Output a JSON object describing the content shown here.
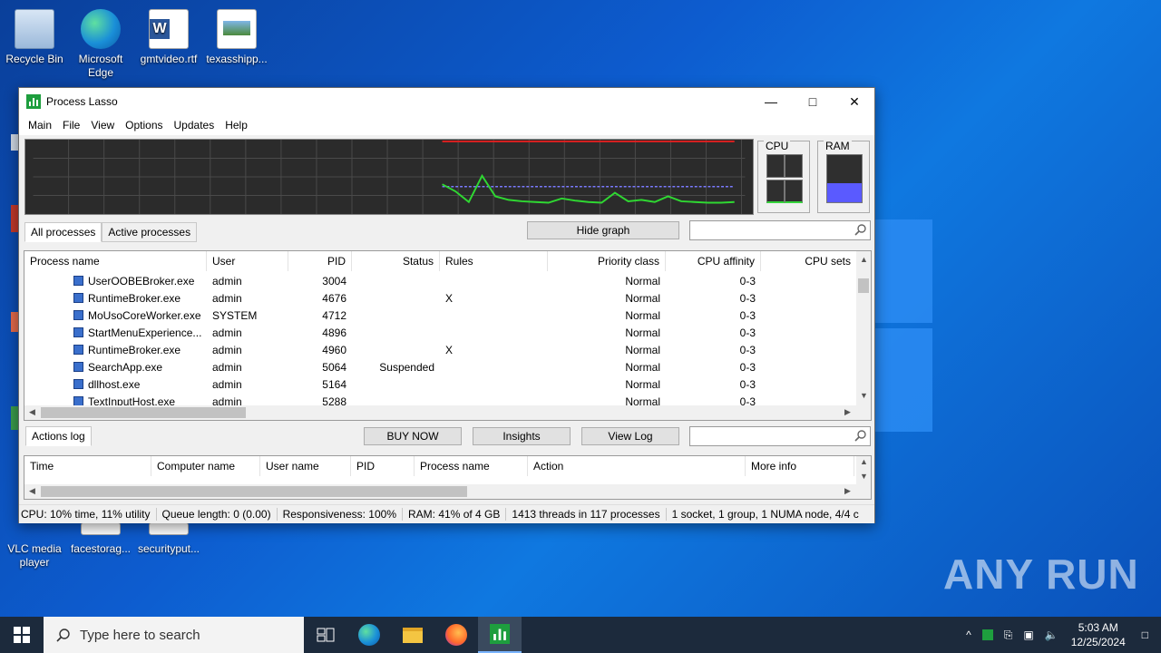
{
  "desktop": {
    "icons_top": [
      {
        "label": "Recycle Bin"
      },
      {
        "label": "Microsoft Edge"
      },
      {
        "label": "gmtvideo.rtf"
      },
      {
        "label": "texasshipp..."
      }
    ],
    "icons_bottom": [
      {
        "label": "VLC media player"
      },
      {
        "label": "facestorag..."
      },
      {
        "label": "securityput..."
      }
    ],
    "watermark": "ANY  RUN"
  },
  "window": {
    "title": "Process Lasso",
    "menu": [
      "Main",
      "File",
      "View",
      "Options",
      "Updates",
      "Help"
    ],
    "graph": {
      "cpu_line": [
        0,
        0,
        0,
        0,
        0,
        0,
        0,
        0,
        0,
        0,
        0,
        0,
        0.32,
        0.22,
        0.07,
        0.44,
        0.15,
        0.1,
        0.08,
        0.07,
        0.06,
        0.12,
        0.09,
        0.07,
        0.06,
        0.2,
        0.08,
        0.1,
        0.07,
        0.15,
        0.08,
        0.07,
        0.06,
        0.06,
        0.07
      ],
      "ram_level": 0.41
    },
    "meters": {
      "cpu_label": "CPU",
      "ram_label": "RAM",
      "ram_fill": 0.41
    },
    "tabs": {
      "all": "All processes",
      "active": "Active processes"
    },
    "hide_graph": "Hide graph",
    "process_table": {
      "columns": [
        "Process name",
        "User",
        "PID",
        "Status",
        "Rules",
        "Priority class",
        "CPU affinity",
        "CPU sets"
      ],
      "rows": [
        {
          "name": "UserOOBEBroker.exe",
          "user": "admin",
          "pid": "3004",
          "status": "",
          "rules": "",
          "priority": "Normal",
          "affinity": "0-3"
        },
        {
          "name": "RuntimeBroker.exe",
          "user": "admin",
          "pid": "4676",
          "status": "",
          "rules": "X",
          "priority": "Normal",
          "affinity": "0-3"
        },
        {
          "name": "MoUsoCoreWorker.exe",
          "user": "SYSTEM",
          "pid": "4712",
          "status": "",
          "rules": "",
          "priority": "Normal",
          "affinity": "0-3"
        },
        {
          "name": "StartMenuExperience...",
          "user": "admin",
          "pid": "4896",
          "status": "",
          "rules": "",
          "priority": "Normal",
          "affinity": "0-3"
        },
        {
          "name": "RuntimeBroker.exe",
          "user": "admin",
          "pid": "4960",
          "status": "",
          "rules": "X",
          "priority": "Normal",
          "affinity": "0-3"
        },
        {
          "name": "SearchApp.exe",
          "user": "admin",
          "pid": "5064",
          "status": "Suspended",
          "rules": "",
          "priority": "Normal",
          "affinity": "0-3"
        },
        {
          "name": "dllhost.exe",
          "user": "admin",
          "pid": "5164",
          "status": "",
          "rules": "",
          "priority": "Normal",
          "affinity": "0-3"
        },
        {
          "name": "TextInputHost.exe",
          "user": "admin",
          "pid": "5288",
          "status": "",
          "rules": "",
          "priority": "Normal",
          "affinity": "0-3"
        }
      ]
    },
    "actions": {
      "tab": "Actions log",
      "buy_now": "BUY NOW",
      "insights": "Insights",
      "view_log": "View Log",
      "columns": [
        "Time",
        "Computer name",
        "User name",
        "PID",
        "Process name",
        "Action",
        "More info"
      ]
    },
    "status": {
      "cpu": "CPU: 10% time, 11% utility",
      "queue": "Queue length: 0 (0.00)",
      "responsiveness": "Responsiveness: 100%",
      "ram": "RAM: 41% of 4 GB",
      "threads": "1413 threads in 117 processes",
      "topology": "1 socket, 1 group, 1 NUMA node, 4/4 c"
    }
  },
  "taskbar": {
    "search_placeholder": "Type here to search",
    "time": "5:03 AM",
    "date": "12/25/2024"
  }
}
